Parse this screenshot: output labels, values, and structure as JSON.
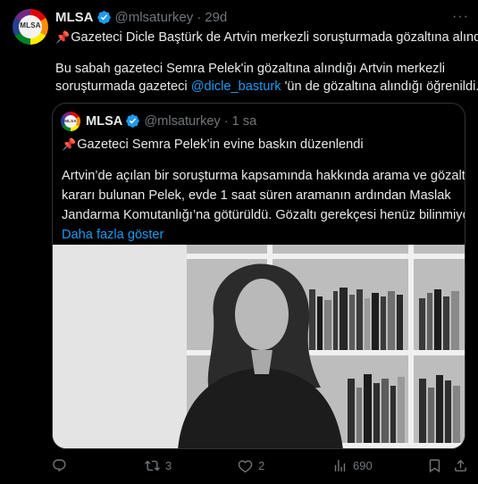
{
  "tweet": {
    "name": "MLSA",
    "handle": "@mlsaturkey",
    "separator": "·",
    "time": "29d",
    "avatar_text": "MLSA",
    "title_line": "Gazeteci Dicle Baştürk de Artvin merkezli soruşturmada gözaltına alındı",
    "body_line1": "Bu sabah gazeteci Semra Pelek'in gözaltına alındığı Artvin merkezli",
    "body_line2_a": "soruşturmada gazeteci ",
    "body_line2_mention": "@dicle_basturk",
    "body_line2_b": " 'ün de gözaltına alındığı öğrenildi."
  },
  "quote": {
    "name": "MLSA",
    "handle": "@mlsaturkey",
    "separator": "·",
    "time": "1 sa",
    "avatar_text": "MLSA",
    "title_line": "Gazeteci Semra Pelek’in evine baskın düzenlendi",
    "body_line1": "Artvin’de açılan bir soruşturma kapsamında hakkında arama ve gözaltı",
    "body_line2": "kararı bulunan Pelek, evde 1 saat süren aramanın ardından Maslak",
    "body_line3": "Jandarma Komutanlığı’na götürüldü. Gözaltı gerekçesi henüz bilinmiyo…",
    "show_more": "Daha fazla göster"
  },
  "actions": {
    "reply_count": "",
    "retweet_count": "3",
    "like_count": "2",
    "views_count": "690"
  },
  "colors": {
    "accent": "#1d9bf0",
    "muted": "#71767b",
    "pin": "#f4212e",
    "background": "#000000"
  },
  "icons": [
    "verified-badge-icon",
    "more-icon",
    "pin-icon",
    "reply-icon",
    "retweet-icon",
    "like-icon",
    "views-icon",
    "bookmark-icon",
    "share-icon"
  ]
}
